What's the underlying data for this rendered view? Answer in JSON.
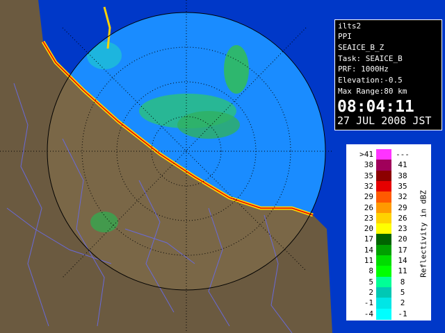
{
  "info": {
    "site": "ilts2",
    "product": "PPI",
    "product_name": "SEAICE_B_Z",
    "task": "Task: SEAICE_B",
    "prf": "PRF: 1000Hz",
    "elevation": "Elevation:-0.5",
    "max_range": "Max Range:80 km",
    "time": "08:04:11",
    "date": "27 JUL 2008 JST"
  },
  "legend": {
    "unit": "Reflectivity in dBZ",
    "rows": [
      {
        "low": ">41",
        "high": "---",
        "color": "#ff33ff"
      },
      {
        "low": "38",
        "high": "41",
        "color": "#a0005a"
      },
      {
        "low": "35",
        "high": "38",
        "color": "#8c0000"
      },
      {
        "low": "32",
        "high": "35",
        "color": "#e60000"
      },
      {
        "low": "29",
        "high": "32",
        "color": "#ff5a00"
      },
      {
        "low": "26",
        "high": "29",
        "color": "#ff9a00"
      },
      {
        "low": "23",
        "high": "26",
        "color": "#ffd200"
      },
      {
        "low": "20",
        "high": "23",
        "color": "#ffff00"
      },
      {
        "low": "17",
        "high": "20",
        "color": "#006400"
      },
      {
        "low": "14",
        "high": "17",
        "color": "#00a000"
      },
      {
        "low": "11",
        "high": "14",
        "color": "#00dc00"
      },
      {
        "low": "8",
        "high": "11",
        "color": "#00ff00"
      },
      {
        "low": "5",
        "high": "8",
        "color": "#00ff96"
      },
      {
        "low": "2",
        "high": "5",
        "color": "#00c8b4"
      },
      {
        "low": "-1",
        "high": "2",
        "color": "#00e6e6"
      },
      {
        "low": "-4",
        "high": "-1",
        "color": "#00ffff"
      }
    ]
  },
  "colors": {
    "ocean": "#0a55ff",
    "radar_field": "#1a8cff",
    "land": "#6b5a40",
    "rivers": "#6a6ad8"
  }
}
